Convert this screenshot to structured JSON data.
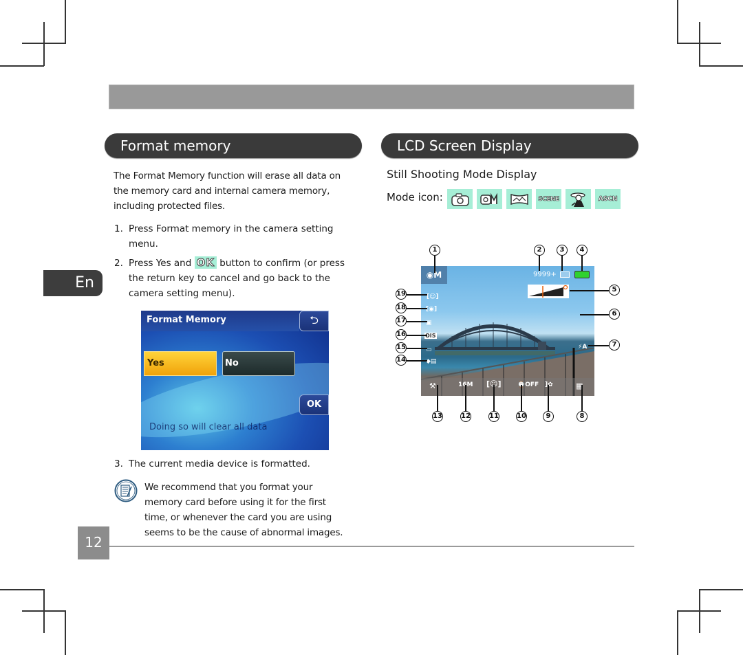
{
  "page": {
    "language_tab": "En",
    "page_number": "12"
  },
  "left_section": {
    "title": "Format memory",
    "intro": "The Format Memory function will erase all data on the memory card and internal camera memory, including protected files.",
    "intro_lines": [
      "The Format Memory function will erase all data on",
      "the memory card and internal camera memory,",
      "including protected files."
    ],
    "steps": [
      {
        "num": "1.",
        "lines": [
          "Press Format memory in the camera setting",
          "menu."
        ]
      },
      {
        "num": "2.",
        "line1_pre": "Press Yes and",
        "ok_icon": "OK",
        "line1_post": "button to confirm (or press",
        "lines_rest": [
          "the return key to cancel and go back to the",
          "camera setting menu)."
        ]
      },
      {
        "num": "3.",
        "lines": [
          "The current media device is formatted."
        ]
      }
    ],
    "screen": {
      "title": "Format Memory",
      "back_icon": "return-arrow-icon",
      "yes_label": "Yes",
      "no_label": "No",
      "ok_label": "OK",
      "message": "Doing so will clear all data"
    },
    "note": {
      "icon": "note-icon",
      "lines": [
        "We recommend that you format your",
        "memory card before using it for the first",
        "time, or whenever the card you are using",
        "seems to be the cause of abnormal images."
      ]
    }
  },
  "right_section": {
    "title": "LCD Screen Display",
    "subheading": "Still Shooting Mode Display",
    "mode_label": "Mode icon:",
    "mode_icons": [
      {
        "name": "auto-camera-icon",
        "text": ""
      },
      {
        "name": "manual-camera-icon",
        "text": ""
      },
      {
        "name": "panorama-icon",
        "text": ""
      },
      {
        "name": "scene-icon",
        "text": "SCENE"
      },
      {
        "name": "portrait-scene-icon",
        "text": ""
      },
      {
        "name": "auto-scene-icon",
        "text": "ASCN"
      }
    ],
    "lcd": {
      "mode_text": "M",
      "shots_remaining": "9999+",
      "flash_label": "⚡A",
      "stabilizer_label": "OIS",
      "self_timer_label": "OFF",
      "callouts": [
        "1",
        "2",
        "3",
        "4",
        "5",
        "6",
        "7",
        "8",
        "9",
        "10",
        "11",
        "12",
        "13",
        "14",
        "15",
        "16",
        "17",
        "18",
        "19"
      ]
    }
  },
  "colors": {
    "section_pill": "#3a3a3a",
    "top_bar": "#999999",
    "icon_highlight": "#a6eed6",
    "page_num_bg": "#8c8c8c"
  }
}
